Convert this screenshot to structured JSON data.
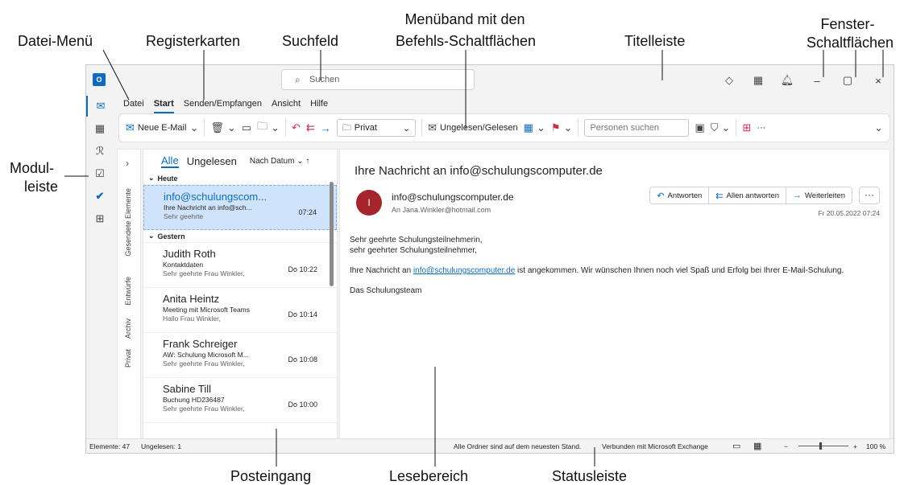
{
  "callouts": {
    "datei_menu": "Datei-Menü",
    "registerkarten": "Registerkarten",
    "suchfeld": "Suchfeld",
    "menueband_1": "Menüband mit den",
    "menueband_2": "Befehls-Schaltflächen",
    "titelleiste": "Titelleiste",
    "fenster_1": "Fenster-",
    "fenster_2": "Schaltflächen",
    "modul_1": "Modul-",
    "modul_2": "leiste",
    "posteingang": "Posteingang",
    "lesebereich": "Lesebereich",
    "statusleiste": "Statusleiste"
  },
  "window": {
    "app_logo": "O",
    "search_placeholder": "Suchen",
    "title_icons": [
      "diamond-icon",
      "grid-icon",
      "bell-icon"
    ],
    "window_buttons": {
      "minimize": "–",
      "maximize": "▢",
      "close": "×"
    }
  },
  "menu": {
    "file": "Datei",
    "start": "Start",
    "send_receive": "Senden/Empfangen",
    "view": "Ansicht",
    "help": "Hilfe"
  },
  "ribbon": {
    "new_mail": "Neue E-Mail",
    "category": "Privat",
    "unread_read": "Ungelesen/Gelesen",
    "people_search": "Personen suchen",
    "more": "···"
  },
  "folder_pane": {
    "expand": "›",
    "folders": [
      "Gesendete Elemente",
      "Entwürfe",
      "Archiv",
      "Privat"
    ]
  },
  "inbox": {
    "tab_all": "Alle",
    "tab_unread": "Ungelesen",
    "sort": "Nach Datum",
    "group_today": "Heute",
    "group_yesterday": "Gestern",
    "today": [
      {
        "sender": "info@schulungscom...",
        "subject": "Ihre Nachricht an info@sch...",
        "preview": "Sehr geehrte",
        "time": "07:24"
      }
    ],
    "yesterday": [
      {
        "sender": "Judith Roth",
        "subject": "Kontaktdaten",
        "preview": "Sehr geehrte Frau Winkler,",
        "time": "Do 10:22"
      },
      {
        "sender": "Anita Heintz",
        "subject": "Meeting mit Microsoft Teams",
        "preview": "Hallo Frau Winkler,",
        "time": "Do 10:14"
      },
      {
        "sender": "Frank Schreiger",
        "subject": "AW: Schulung Microsoft M...",
        "preview": "Sehr geehrte Frau Winkler,",
        "time": "Do 10:08"
      },
      {
        "sender": "Sabine Till",
        "subject": "Buchung HD236487",
        "preview": "Sehr geehrte Frau Winkler,",
        "time": "Do 10:00"
      }
    ]
  },
  "reading": {
    "subject": "Ihre Nachricht an info@schulungscomputer.de",
    "avatar": "I",
    "from": "info@schulungscomputer.de",
    "to": "An  Jana.Winkler@hotmail.com",
    "reply": "Antworten",
    "reply_all": "Allen antworten",
    "forward": "Weiterleiten",
    "more": "···",
    "date": "Fr 20.05.2022 07:24",
    "body_greeting_1": "Sehr geehrte Schulungsteilnehmerin,",
    "body_greeting_2": "sehr geehrter Schulungsteilnehmer,",
    "body_text_pre": "Ihre Nachricht an ",
    "body_link": "info@schulungscomputer.de",
    "body_text_post": " ist angekommen. Wir wünschen Ihnen noch viel Spaß und Erfolg bei Ihrer E-Mail-Schulung.",
    "body_sign": "Das Schulungsteam"
  },
  "status": {
    "items": "Elemente: 47",
    "unread": "Ungelesen: 1",
    "folders_state": "Alle Ordner sind auf dem neuesten Stand.",
    "connection": "Verbunden mit Microsoft Exchange",
    "zoom_minus": "−",
    "zoom_plus": "+",
    "zoom": "100 %"
  }
}
